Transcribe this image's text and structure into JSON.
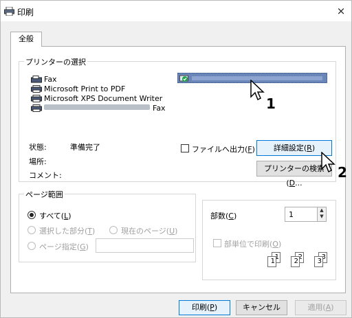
{
  "window": {
    "title": "印刷",
    "close_glyph": "×"
  },
  "tabs": [
    {
      "label": "全般"
    }
  ],
  "printer_select": {
    "title": "プリンターの選択",
    "printers": [
      {
        "label": "Fax",
        "icon": "fax-icon"
      },
      {
        "label": "Microsoft Print to PDF",
        "icon": "printer-icon"
      },
      {
        "label": "Microsoft XPS Document Writer",
        "icon": "printer-icon"
      },
      {
        "label": "Fax",
        "icon": "printer-icon"
      }
    ],
    "status_label": "状態:",
    "status_value": "準備完了",
    "location_label": "場所:",
    "comment_label": "コメント:",
    "print_to_file_label": "ファイルへ出力(",
    "print_to_file_key": "F",
    "preferences_label": "詳細設定(",
    "preferences_key": "R",
    "find_printer_label": "プリンターの検索(",
    "find_printer_key": "D",
    "find_printer_suffix": "..."
  },
  "page_range": {
    "title": "ページ範囲",
    "all_label": "すべて(",
    "all_key": "L",
    "selection_label": "選択した部分(",
    "selection_key": "T",
    "current_label": "現在のページ(",
    "current_key": "U",
    "pages_label": "ページ指定(",
    "pages_key": "G",
    "pages_value": ""
  },
  "copies": {
    "label": "部数(",
    "key": "C",
    "value": "1",
    "collate_label": "部単位で印刷(",
    "collate_key": "O",
    "collate_pages": [
      "1",
      "1",
      "2",
      "2",
      "3",
      "3"
    ]
  },
  "footer": {
    "print_label": "印刷(",
    "print_key": "P",
    "cancel_label": "キャンセル",
    "apply_label": "適用(",
    "apply_key": "A"
  },
  "annotations": {
    "cursor_1": "1",
    "cursor_2": "2"
  }
}
